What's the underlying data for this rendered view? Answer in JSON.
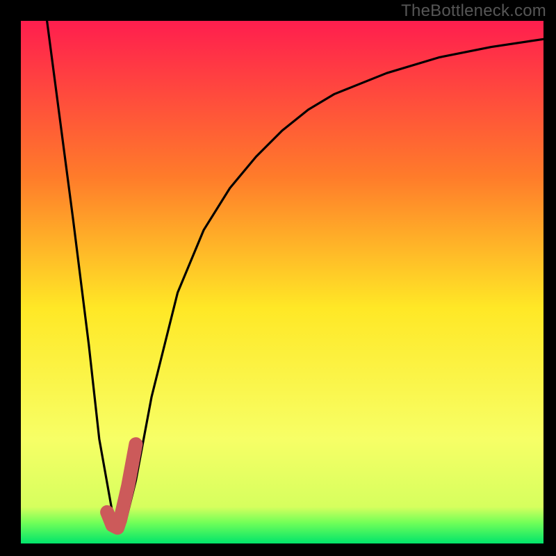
{
  "header": {
    "watermark": "TheBottleneck.com"
  },
  "chart_data": {
    "type": "line",
    "title": "",
    "xlabel": "",
    "ylabel": "",
    "xlim": [
      0,
      100
    ],
    "ylim": [
      0,
      100
    ],
    "series": [
      {
        "name": "bottleneck-curve",
        "x": [
          5,
          10,
          13,
          15,
          17.5,
          18.5,
          20,
          22,
          25,
          30,
          35,
          40,
          45,
          50,
          55,
          60,
          70,
          80,
          90,
          100
        ],
        "values": [
          100,
          62,
          38,
          20,
          6,
          3,
          4,
          12,
          28,
          48,
          60,
          68,
          74,
          79,
          83,
          86,
          90,
          93,
          95,
          96.5
        ]
      }
    ],
    "highlight": {
      "name": "tick-mark",
      "x": [
        16.5,
        17.5,
        18.5,
        18.5,
        19.0,
        20.5,
        22.0
      ],
      "values": [
        6,
        3.5,
        3,
        3,
        4.5,
        11,
        19
      ]
    },
    "gradient": {
      "top": "#ff1e4e",
      "upper_mid": "#ff7c2a",
      "mid": "#ffe826",
      "lower_mid": "#f7ff66",
      "bottom_band": "#72ff58",
      "bottom": "#00e46b"
    }
  }
}
